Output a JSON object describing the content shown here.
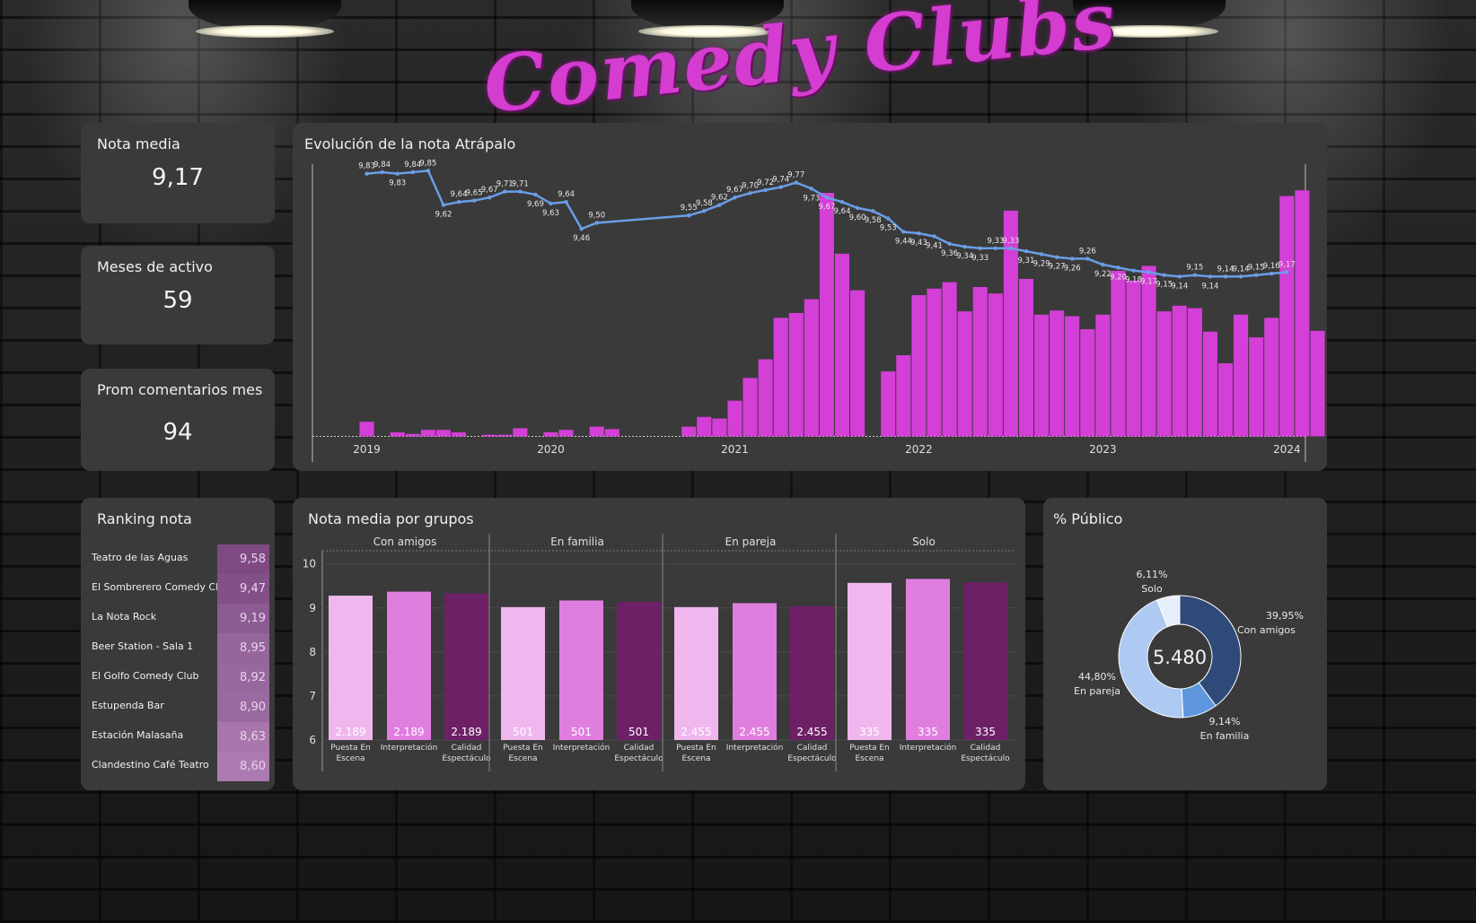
{
  "dashboard": {
    "logo": "Comedy Clubs",
    "kpis": [
      {
        "label": "Nota media",
        "value": "9,17"
      },
      {
        "label": "Meses de activo",
        "value": "59"
      },
      {
        "label": "Prom comentarios mes",
        "value": "94"
      }
    ]
  },
  "evolution": {
    "title": "Evolución de la nota Atrápalo",
    "year_labels": [
      "2019",
      "2020",
      "2021",
      "2022",
      "2023",
      "2024"
    ]
  },
  "ranking": {
    "title": "Ranking nota",
    "rows": [
      {
        "name": "Teatro de las Aguas",
        "value": "9,58",
        "color": "#7f4a82"
      },
      {
        "name": "El Sombrerero Comedy Club",
        "value": "9,47",
        "color": "#83508a"
      },
      {
        "name": "La Nota Rock",
        "value": "9,19",
        "color": "#8c5b93"
      },
      {
        "name": "Beer Station - Sala 1",
        "value": "8,95",
        "color": "#95659c"
      },
      {
        "name": "El Golfo Comedy Club",
        "value": "8,92",
        "color": "#9867a0"
      },
      {
        "name": "Estupenda Bar",
        "value": "8,90",
        "color": "#9b69a2"
      },
      {
        "name": "Estación Malasaña",
        "value": "8,63",
        "color": "#a876ac"
      },
      {
        "name": "Clandestino Café Teatro",
        "value": "8,60",
        "color": "#ac7ab0"
      }
    ]
  },
  "groups": {
    "title": "Nota media por grupos"
  },
  "publico": {
    "title": "% Público",
    "center_value": "5.480"
  },
  "chart_data": [
    {
      "type": "bar+line",
      "title": "Evolución de la nota Atrápalo",
      "x_start": "2019-01",
      "x_range": [
        "2018-09",
        "2024-01"
      ],
      "bars_comments": [
        18,
        0,
        5,
        3,
        8,
        8,
        5,
        0,
        2,
        2,
        10,
        0,
        5,
        8,
        0,
        12,
        9,
        0,
        0,
        0,
        0,
        12,
        24,
        22,
        44,
        72,
        95,
        146,
        152,
        169,
        300,
        225,
        180,
        0,
        80,
        100,
        174,
        182,
        190,
        154,
        184,
        176,
        278,
        194,
        150,
        155,
        148,
        132,
        150,
        204,
        192,
        210,
        154,
        161,
        158,
        129,
        90,
        150,
        122,
        146,
        296,
        303,
        130
      ],
      "line_labels": [
        [
          "2019-01",
          "9,83"
        ],
        [
          "2019-02",
          "9,84"
        ],
        [
          "2019-03",
          "9,83"
        ],
        [
          "2019-04",
          "9,84"
        ],
        [
          "2019-05",
          "9,85"
        ],
        [
          "2019-06",
          "9,62"
        ],
        [
          "2019-07",
          "9,64"
        ],
        [
          "2019-08",
          "9,65"
        ],
        [
          "2019-09",
          "9,67"
        ],
        [
          "2019-10",
          "9,71"
        ],
        [
          "2019-11",
          "9,71"
        ],
        [
          "2019-12",
          "9,69"
        ],
        [
          "2020-01",
          "9,63"
        ],
        [
          "2020-02",
          "9,64"
        ],
        [
          "2020-03",
          "9,46"
        ],
        [
          "2020-04",
          "9,50"
        ],
        [
          "2020-10",
          "9,55"
        ],
        [
          "2020-11",
          "9,58"
        ],
        [
          "2020-12",
          "9,62"
        ],
        [
          "2021-01",
          "9,67"
        ],
        [
          "2021-02",
          "9,70"
        ],
        [
          "2021-03",
          "9,72"
        ],
        [
          "2021-04",
          "9,74"
        ],
        [
          "2021-05",
          "9,77"
        ],
        [
          "2021-06",
          "9,73"
        ],
        [
          "2021-07",
          "9,67"
        ],
        [
          "2021-08",
          "9,64"
        ],
        [
          "2021-09",
          "9,60"
        ],
        [
          "2021-10",
          "9,58"
        ],
        [
          "2021-11",
          "9,53"
        ],
        [
          "2021-12",
          "9,44"
        ],
        [
          "2022-01",
          "9,43"
        ],
        [
          "2022-02",
          "9,41"
        ],
        [
          "2022-03",
          "9,36"
        ],
        [
          "2022-04",
          "9,34"
        ],
        [
          "2022-05",
          "9,33"
        ],
        [
          "2022-06",
          "9,33"
        ],
        [
          "2022-07",
          "9,33"
        ],
        [
          "2022-08",
          "9,31"
        ],
        [
          "2022-09",
          "9,29"
        ],
        [
          "2022-10",
          "9,27"
        ],
        [
          "2022-11",
          "9,26"
        ],
        [
          "2022-12",
          "9,26"
        ],
        [
          "2023-01",
          "9,22"
        ],
        [
          "2023-02",
          "9,20"
        ],
        [
          "2023-03",
          "9,18"
        ],
        [
          "2023-04",
          "9,17"
        ],
        [
          "2023-05",
          "9,15"
        ],
        [
          "2023-06",
          "9,14"
        ],
        [
          "2023-07",
          "9,15"
        ],
        [
          "2023-08",
          "9,14"
        ],
        [
          "2023-09",
          "9,14"
        ],
        [
          "2023-10",
          "9,14"
        ],
        [
          "2023-11",
          "9,15"
        ],
        [
          "2023-12",
          "9,16"
        ],
        [
          "2024-01",
          "9,17"
        ]
      ],
      "legend": "none"
    },
    {
      "type": "bar",
      "title": "Nota media por grupos",
      "facets": [
        "Con amigos",
        "En familia",
        "En pareja",
        "Solo"
      ],
      "categories": [
        "Puesta En Escena",
        "Interpretación",
        "Calidad Espectáculo"
      ],
      "series": [
        {
          "facet": "Con amigos",
          "values": [
            9.28,
            9.37,
            9.33
          ],
          "labels": [
            "2.189",
            "2.189",
            "2.189"
          ]
        },
        {
          "facet": "En familia",
          "values": [
            9.02,
            9.17,
            9.14
          ],
          "labels": [
            "501",
            "501",
            "501"
          ]
        },
        {
          "facet": "En pareja",
          "values": [
            9.02,
            9.11,
            9.04
          ],
          "labels": [
            "2.455",
            "2.455",
            "2.455"
          ]
        },
        {
          "facet": "Solo",
          "values": [
            9.57,
            9.66,
            9.58
          ],
          "labels": [
            "335",
            "335",
            "335"
          ]
        }
      ],
      "bar_colors": [
        "#f0b7ef",
        "#e07ee0",
        "#6e2067"
      ],
      "y_ticks": [
        "6",
        "7",
        "8",
        "9",
        "10"
      ],
      "ylim": [
        6,
        10.3
      ]
    },
    {
      "type": "pie",
      "title": "% Público",
      "slices": [
        {
          "name": "Con amigos",
          "percent": 39.95,
          "label": "39,95%",
          "color": "#2f4a79"
        },
        {
          "name": "En familia",
          "percent": 9.14,
          "label": "9,14%",
          "color": "#5e97de"
        },
        {
          "name": "En pareja",
          "percent": 44.8,
          "label": "44,80%",
          "color": "#aec9f2"
        },
        {
          "name": "Solo",
          "percent": 6.11,
          "label": "6,11%",
          "color": "#e7eefb"
        }
      ],
      "center_label": "5.480"
    }
  ]
}
